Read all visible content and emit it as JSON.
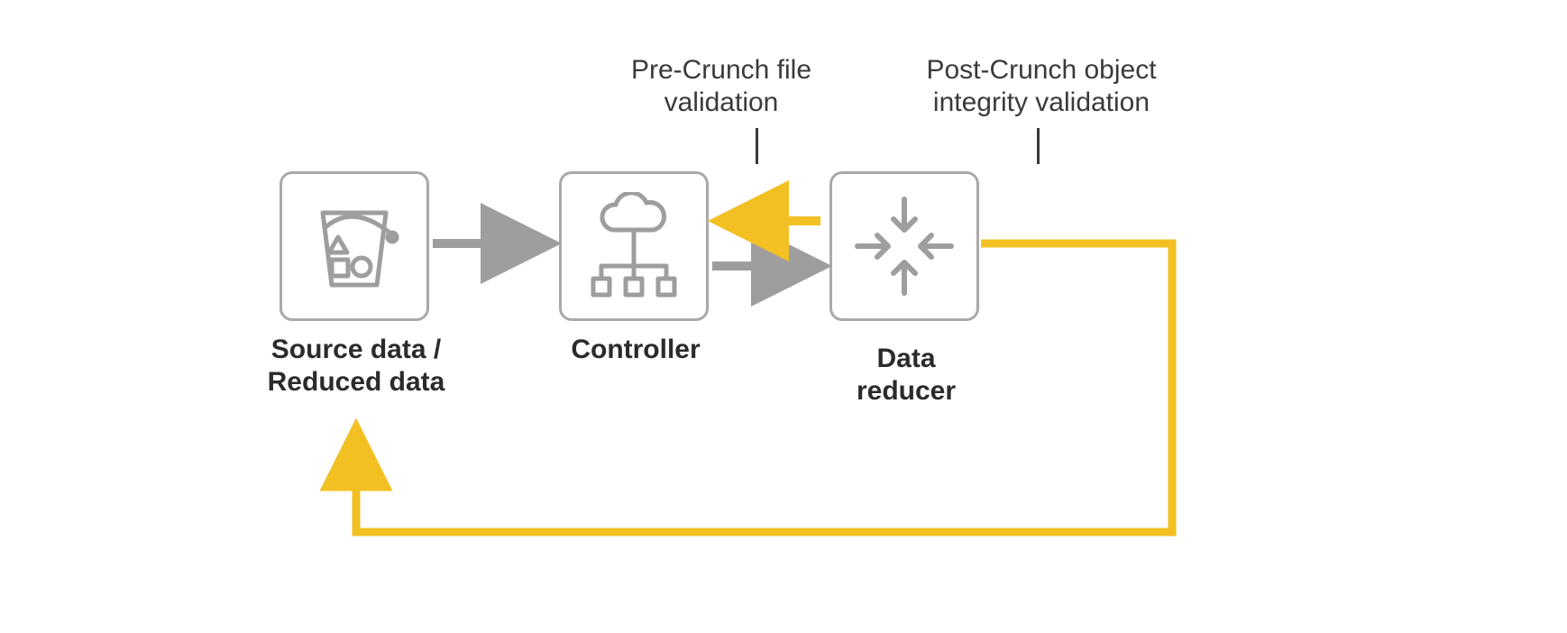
{
  "callouts": {
    "pre_l1": "Pre-Crunch file",
    "pre_l2": "validation",
    "post_l1": "Post-Crunch object",
    "post_l2": "integrity validation"
  },
  "nodes": {
    "source": {
      "label_l1": "Source data /",
      "label_l2": "Reduced data"
    },
    "controller": {
      "label": "Controller"
    },
    "reducer": {
      "label_l1": "Data",
      "label_l2": "reducer"
    }
  },
  "colors": {
    "gray": "#9e9e9e",
    "yellow": "#f2c023",
    "text": "#2b2b2b"
  }
}
